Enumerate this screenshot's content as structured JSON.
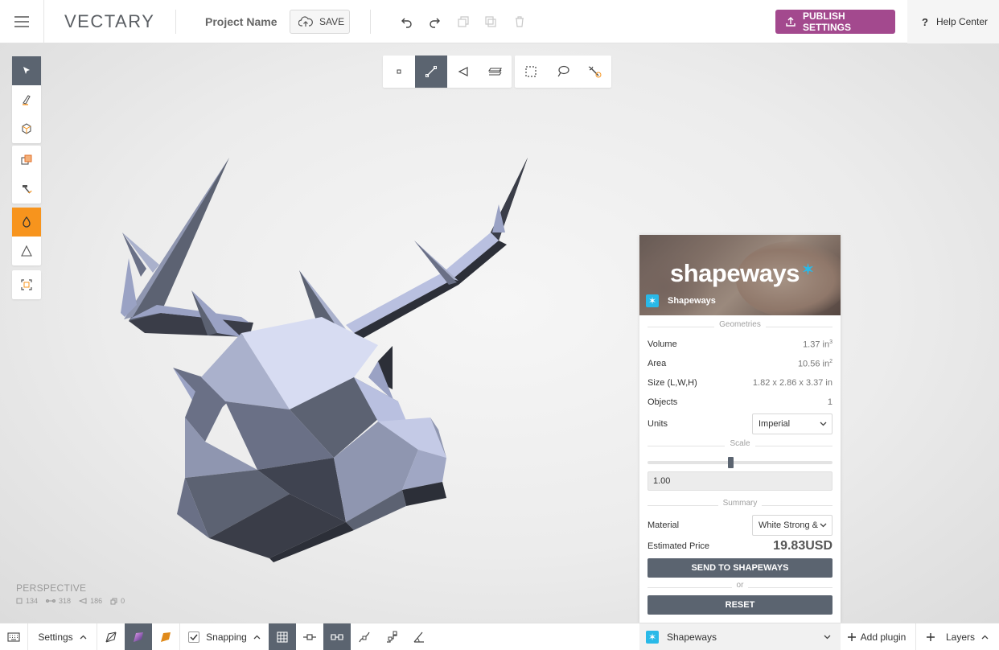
{
  "header": {
    "logo": "VECTARY",
    "project_name": "Project Name",
    "save_label": "SAVE",
    "publish_label": "PUBLISH SETTINGS",
    "help_label": "Help Center",
    "help_glyph": "?"
  },
  "viewport": {
    "camera_label": "PERSPECTIVE",
    "stats": {
      "vertices": "134",
      "edges": "318",
      "faces": "186",
      "objects": "0"
    }
  },
  "shapeways": {
    "banner_logo": "shapeways",
    "banner_star": "✶",
    "plugin_name": "Shapeways",
    "badge_glyph": "✶",
    "geometries_title": "Geometries",
    "volume_label": "Volume",
    "volume_value": "1.37 in",
    "volume_unit_sup": "3",
    "area_label": "Area",
    "area_value": "10.56 in",
    "area_unit_sup": "2",
    "size_label": "Size (L,W,H)",
    "size_value": "1.82 x 2.86 x 3.37 in",
    "objects_label": "Objects",
    "objects_value": "1",
    "units_label": "Units",
    "units_value": "Imperial",
    "scale_title": "Scale",
    "scale_value": "1.00",
    "scale_fraction": 0.45,
    "summary_title": "Summary",
    "material_label": "Material",
    "material_value": "White Strong &",
    "price_label": "Estimated Price",
    "price_value": "19.83USD",
    "send_label": "SEND TO SHAPEWAYS",
    "or_label": "or",
    "reset_label": "RESET"
  },
  "bottombar": {
    "settings_label": "Settings",
    "snapping_label": "Snapping",
    "plugin_selected": "Shapeways",
    "add_plugin_label": "Add plugin",
    "layers_label": "Layers"
  },
  "colors": {
    "accent_publish": "#a3498e",
    "active_tool": "#5b6470",
    "active_material": "#f7941d",
    "shapeways_blue": "#29b9e8"
  },
  "icons": {
    "menu": "hamburger-icon",
    "undo": "undo-icon",
    "redo": "redo-icon",
    "select": "cursor-arrow-icon",
    "pen": "pen-tool-icon",
    "cube": "cube-icon",
    "boolean": "boolean-icon",
    "hammer": "hammer-icon",
    "material": "drop-icon",
    "triangle": "triangle-icon",
    "fit": "fit-view-icon"
  }
}
